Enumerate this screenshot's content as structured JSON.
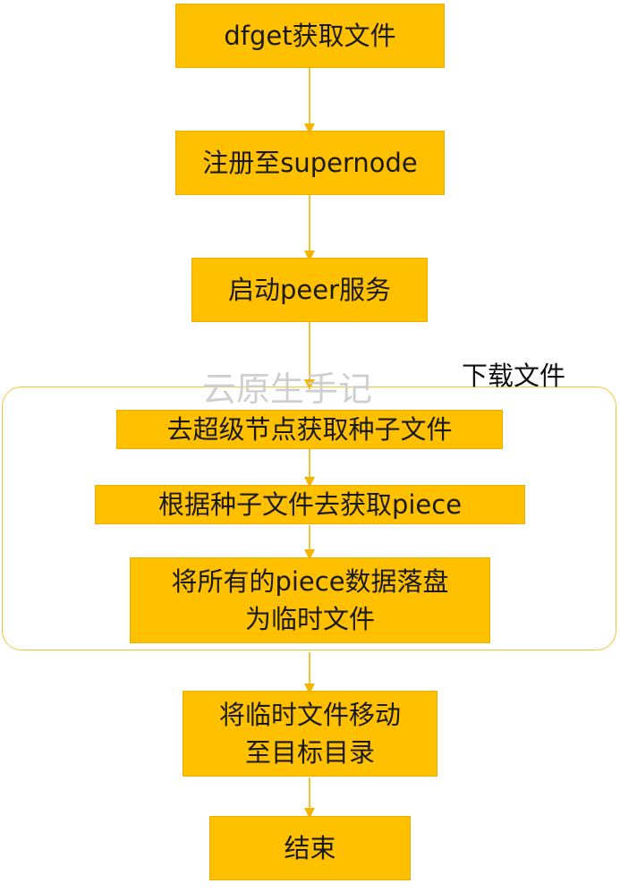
{
  "colors": {
    "box_fill": "#FFC000",
    "connector": "#F5B400",
    "group_border": "#F0C53A",
    "watermark": "#CFCFCF"
  },
  "steps": {
    "dfget": "dfget获取文件",
    "register": "注册至supernode",
    "start_peer": "启动peer服务",
    "seed_from_supernode": "去超级节点获取种子文件",
    "get_piece": "根据种子文件去获取piece",
    "persist_line1": "将所有的piece数据落盘",
    "persist_line2": "为临时文件",
    "move_line1": "将临时文件移动",
    "move_line2": "至目标目录",
    "end": "结束"
  },
  "group": {
    "label": "下载文件"
  },
  "watermark": "云原生手记"
}
